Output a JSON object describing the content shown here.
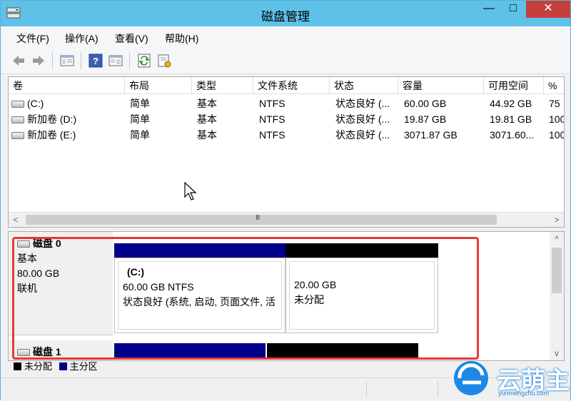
{
  "window": {
    "title": "磁盘管理"
  },
  "window_buttons": {
    "minimize": "—",
    "maximize": "□",
    "close": "✕"
  },
  "menu": [
    {
      "label": "文件(F)"
    },
    {
      "label": "操作(A)"
    },
    {
      "label": "查看(V)"
    },
    {
      "label": "帮助(H)"
    }
  ],
  "toolbar": {
    "buttons": [
      "back-icon",
      "forward-icon",
      "list-view-icon",
      "help-icon",
      "properties-icon",
      "refresh-icon",
      "export-icon"
    ]
  },
  "volume_list": {
    "columns": [
      "卷",
      "布局",
      "类型",
      "文件系统",
      "状态",
      "容量",
      "可用空间",
      "%"
    ],
    "rows": [
      {
        "volume": "(C:)",
        "layout": "简单",
        "type": "基本",
        "fs": "NTFS",
        "status": "状态良好 (...",
        "capacity": "60.00 GB",
        "free": "44.92 GB",
        "pct": "75"
      },
      {
        "volume": "新加卷 (D:)",
        "layout": "简单",
        "type": "基本",
        "fs": "NTFS",
        "status": "状态良好 (...",
        "capacity": "19.87 GB",
        "free": "19.81 GB",
        "pct": "100"
      },
      {
        "volume": "新加卷 (E:)",
        "layout": "简单",
        "type": "基本",
        "fs": "NTFS",
        "status": "状态良好 (...",
        "capacity": "3071.87 GB",
        "free": "3071.60...",
        "pct": "100"
      }
    ],
    "scroll_grip": "III"
  },
  "disks": [
    {
      "name": "磁盘 0",
      "type": "基本",
      "size": "80.00 GB",
      "state": "联机"
    },
    {
      "name": "磁盘 1"
    }
  ],
  "partitions": {
    "c_drive": {
      "label": "(C:)",
      "size": "60.00 GB NTFS",
      "status": "状态良好 (系统, 启动, 页面文件, 活"
    },
    "unallocated": {
      "size": "20.00 GB",
      "status": "未分配"
    }
  },
  "legend": [
    {
      "label": "未分配",
      "color": "#000000"
    },
    {
      "label": "主分区",
      "color": "#00008b"
    }
  ],
  "colors": {
    "titlebar": "#5ec1e8",
    "close": "#c5403a",
    "highlight": "#e53935",
    "primary_partition": "#00008b",
    "unallocated": "#000000"
  },
  "watermark": {
    "brand": "云萌主",
    "url": "yunmengzhu.com"
  }
}
